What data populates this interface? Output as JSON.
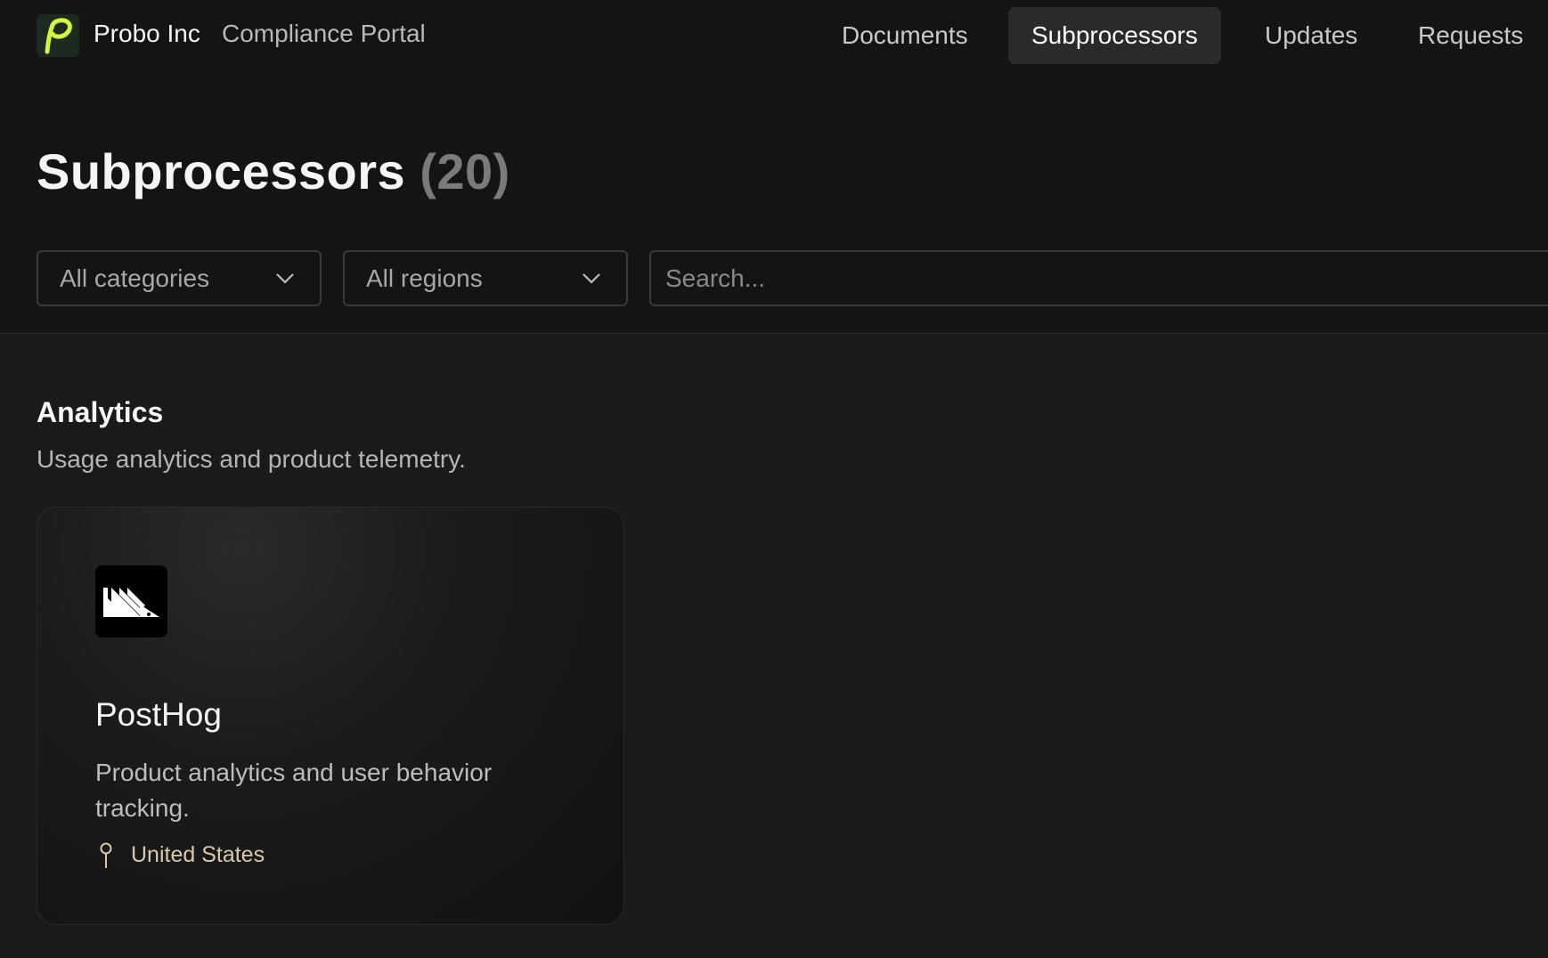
{
  "header": {
    "brand": "Probo Inc",
    "portal_label": "Compliance Portal",
    "logo_icon": "probo-p-logo-icon",
    "accent_color": "#d4f53c",
    "nav": [
      {
        "label": "Documents",
        "active": false
      },
      {
        "label": "Subprocessors",
        "active": true
      },
      {
        "label": "Updates",
        "active": false
      },
      {
        "label": "Requests",
        "active": false
      }
    ]
  },
  "page": {
    "title": "Subprocessors",
    "count": "(20)"
  },
  "filters": {
    "category": {
      "selected": "All categories",
      "icon": "chevron-down-icon"
    },
    "region": {
      "selected": "All regions",
      "icon": "chevron-down-icon"
    },
    "search": {
      "placeholder": "Search...",
      "value": ""
    }
  },
  "sections": [
    {
      "title": "Analytics",
      "description": "Usage analytics and product telemetry.",
      "vendors": [
        {
          "name": "PostHog",
          "description": "Product analytics and user behavior tracking.",
          "location": "United States",
          "logo_icon": "posthog-logo-icon",
          "location_icon": "map-pin-icon"
        }
      ]
    }
  ]
}
